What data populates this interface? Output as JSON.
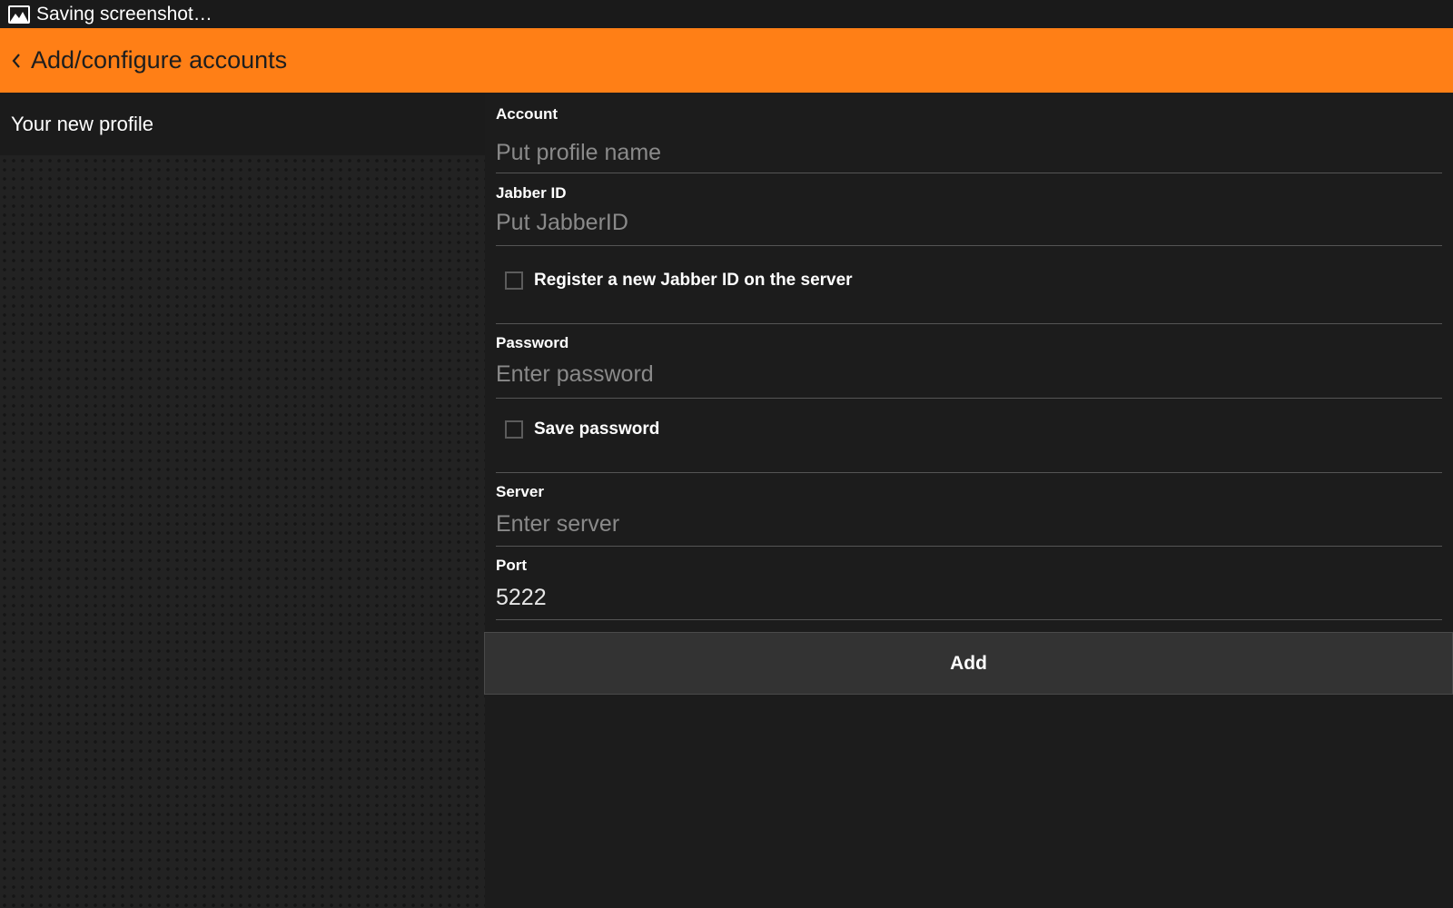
{
  "status_bar": {
    "icon": "image-icon",
    "text": "Saving screenshot…"
  },
  "action_bar": {
    "back_icon": "chevron-left-icon",
    "title": "Add/configure accounts",
    "background_color": "#ff7f16"
  },
  "left_pane": {
    "profile_label": "Your new profile"
  },
  "form": {
    "account": {
      "label": "Account",
      "placeholder": "Put profile name",
      "value": ""
    },
    "jabber_id": {
      "label": "Jabber ID",
      "placeholder": "Put JabberID",
      "value": ""
    },
    "register_checkbox": {
      "label": "Register a new Jabber ID on the server",
      "checked": false
    },
    "password": {
      "label": "Password",
      "placeholder": "Enter password",
      "value": ""
    },
    "save_password_checkbox": {
      "label": "Save password",
      "checked": false
    },
    "server": {
      "label": "Server",
      "placeholder": "Enter server",
      "value": ""
    },
    "port": {
      "label": "Port",
      "placeholder": "",
      "value": "5222"
    },
    "add_button_label": "Add"
  }
}
